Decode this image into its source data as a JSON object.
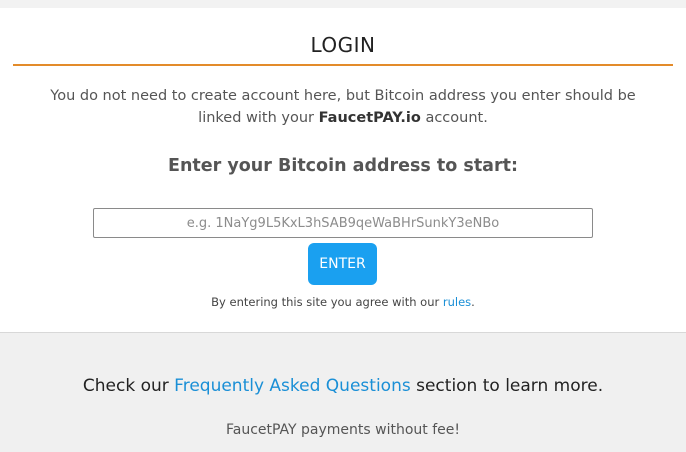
{
  "login": {
    "title": "LOGIN",
    "intro_text": "You do not need to create account here, but Bitcoin address you enter should be linked with your",
    "intro_brand": "FaucetPAY.io",
    "intro_suffix": "account.",
    "prompt": "Enter your Bitcoin address to start:",
    "address_placeholder": "e.g. 1NaYg9L5KxL3hSAB9qeWaBHrSunkY3eNBo",
    "address_value": "",
    "enter_label": "ENTER",
    "agree_prefix": "By entering this site you agree with our",
    "rules_link": "rules",
    "agree_suffix": "."
  },
  "footer": {
    "faq_prefix": "Check our",
    "faq_link": "Frequently Asked Questions",
    "faq_suffix": "section to learn more.",
    "payments_note": "FaucetPAY payments without fee!"
  },
  "colors": {
    "accent_rule": "#e38b2a",
    "button": "#1aa0f0",
    "link": "#1a8fd6"
  }
}
